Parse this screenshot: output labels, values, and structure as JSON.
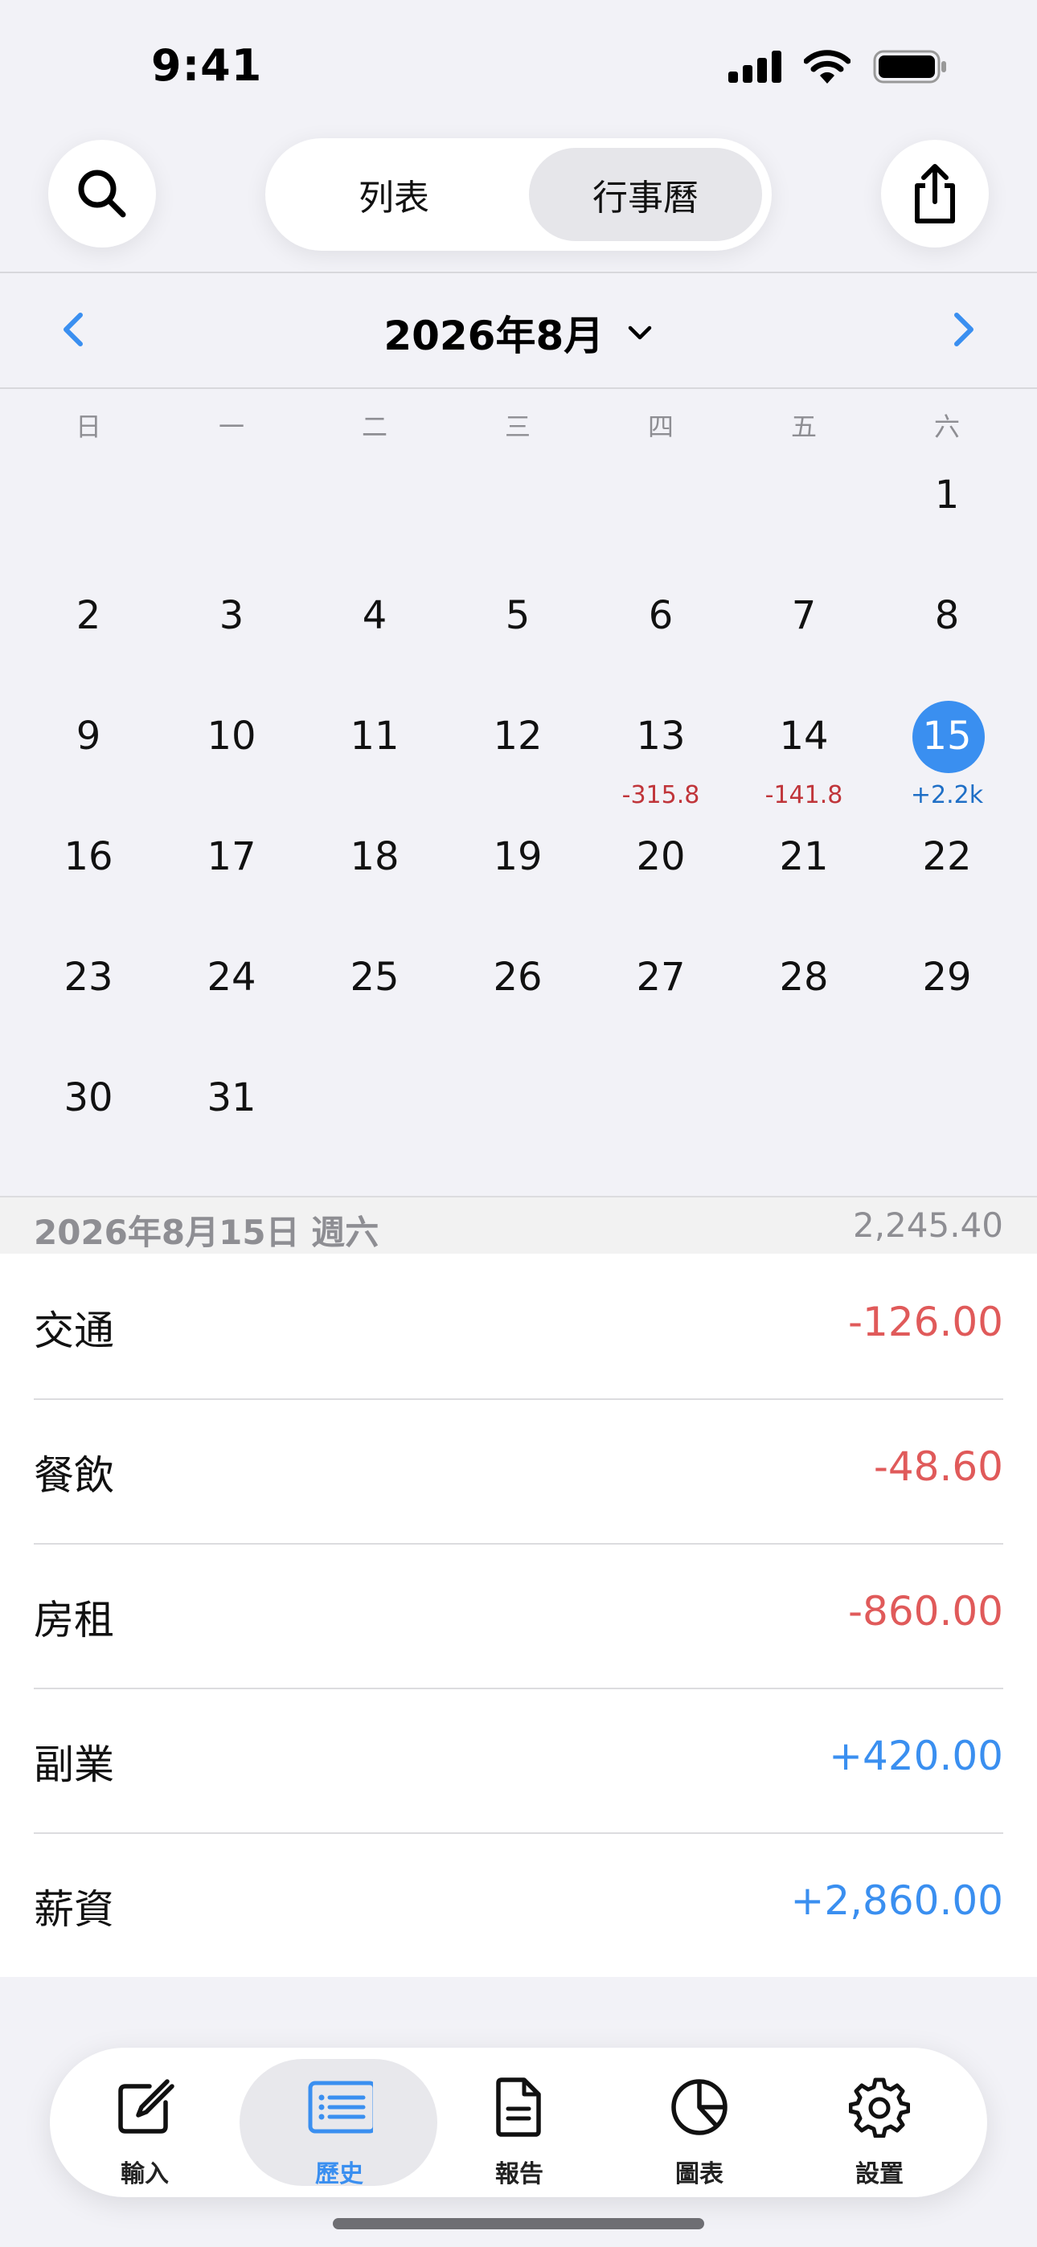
{
  "status_bar": {
    "time": "9:41"
  },
  "header": {
    "segments": [
      {
        "label": "列表"
      },
      {
        "label": "行事曆"
      }
    ],
    "selected_segment": "行事曆"
  },
  "calendar": {
    "month_title": "2026年8月",
    "weekdays": [
      "日",
      "一",
      "二",
      "三",
      "四",
      "五",
      "六"
    ],
    "weeks": [
      [
        "",
        "",
        "",
        "",
        "",
        "",
        "1"
      ],
      [
        "2",
        "3",
        "4",
        "5",
        "6",
        "7",
        "8"
      ],
      [
        "9",
        "10",
        "11",
        "12",
        "13",
        "14",
        "15"
      ],
      [
        "16",
        "17",
        "18",
        "19",
        "20",
        "21",
        "22"
      ],
      [
        "23",
        "24",
        "25",
        "26",
        "27",
        "28",
        "29"
      ],
      [
        "30",
        "31",
        "",
        "",
        "",
        "",
        ""
      ]
    ],
    "selected_day": "15",
    "day_amounts": [
      {
        "day": "13",
        "amount": "-315.8"
      },
      {
        "day": "14",
        "amount": "-141.8"
      },
      {
        "day": "15",
        "amount": "+2.2k"
      }
    ]
  },
  "selected_day": {
    "date_label": "2026年8月15日 週六",
    "total": "2,245.40",
    "entries": [
      {
        "category": "交通",
        "amount": "-126.00",
        "type": "expense"
      },
      {
        "category": "餐飲",
        "amount": "-48.60",
        "type": "expense"
      },
      {
        "category": "房租",
        "amount": "-860.00",
        "type": "expense"
      },
      {
        "category": "副業",
        "amount": "+420.00",
        "type": "income"
      },
      {
        "category": "薪資",
        "amount": "+2,860.00",
        "type": "income"
      }
    ]
  },
  "tabbar": {
    "selected": "歷史",
    "tabs": [
      {
        "label": "輸入",
        "icon": "edit-icon"
      },
      {
        "label": "歷史",
        "icon": "list-icon"
      },
      {
        "label": "報告",
        "icon": "document-icon"
      },
      {
        "label": "圖表",
        "icon": "pie-chart-icon"
      },
      {
        "label": "設置",
        "icon": "gear-icon"
      }
    ]
  },
  "colors": {
    "accent": "#3a8ff0",
    "expense": "#e05a5a",
    "income": "#3a8ff0",
    "background": "#f2f2f7"
  }
}
